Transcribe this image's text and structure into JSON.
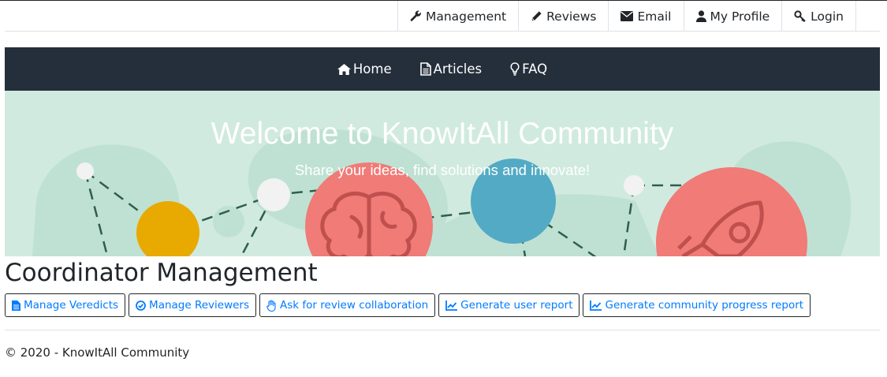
{
  "top_nav": {
    "items": [
      {
        "label": "Management",
        "icon": "wrench-icon"
      },
      {
        "label": "Reviews",
        "icon": "pencil-icon"
      },
      {
        "label": "Email",
        "icon": "envelope-icon"
      },
      {
        "label": "My Profile",
        "icon": "user-icon"
      },
      {
        "label": "Login",
        "icon": "key-icon"
      }
    ]
  },
  "main_nav": {
    "items": [
      {
        "label": "Home",
        "icon": "home-icon"
      },
      {
        "label": "Articles",
        "icon": "document-icon"
      },
      {
        "label": "FAQ",
        "icon": "lightbulb-icon"
      }
    ]
  },
  "hero": {
    "title": "Welcome to KnowItAll Community",
    "subtitle": "Share your ideas, find solutions and innovate!",
    "icons": [
      "brain-icon",
      "rocket-icon"
    ]
  },
  "page": {
    "title": "Coordinator Management"
  },
  "actions": [
    {
      "label": "Manage Veredicts",
      "icon": "file-icon"
    },
    {
      "label": "Manage Reviewers",
      "icon": "check-circle-icon"
    },
    {
      "label": "Ask for review collaboration",
      "icon": "hand-icon"
    },
    {
      "label": "Generate user report",
      "icon": "chart-line-icon"
    },
    {
      "label": "Generate community progress report",
      "icon": "chart-line-icon"
    }
  ],
  "footer": {
    "text": "© 2020 - KnowItAll Community"
  },
  "colors": {
    "nav_dark": "#252f3b",
    "hero_bg": "#d0eadf",
    "link_blue": "#007bff",
    "coral": "#f07b77",
    "teal": "#52aac5",
    "yellow": "#e8a900"
  }
}
